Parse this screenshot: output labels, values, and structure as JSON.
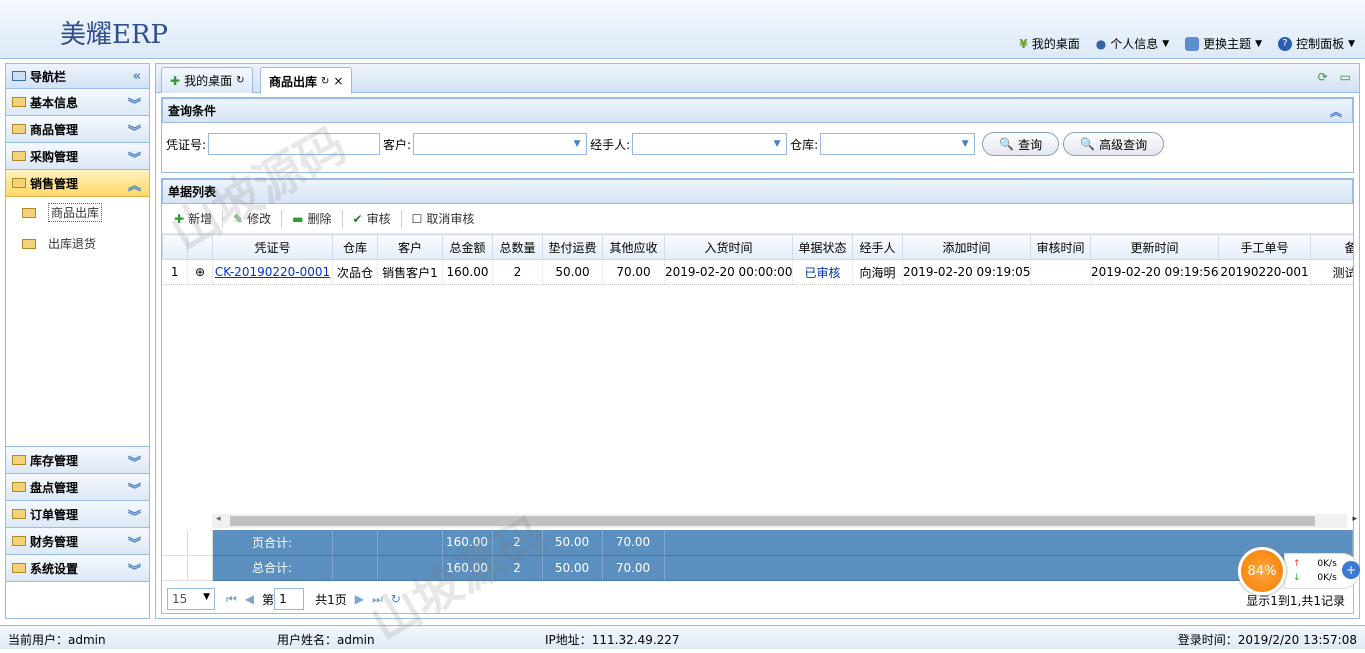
{
  "app": {
    "title": "美耀ERP"
  },
  "topmenu": [
    {
      "label": "我的桌面",
      "icon": "yen-icon",
      "caret": false
    },
    {
      "label": "个人信息",
      "icon": "user-icon",
      "caret": true
    },
    {
      "label": "更换主题",
      "icon": "theme-icon",
      "caret": true
    },
    {
      "label": "控制面板",
      "icon": "help-icon",
      "caret": true
    }
  ],
  "sidebar": {
    "title": "导航栏",
    "groups": [
      {
        "label": "基本信息"
      },
      {
        "label": "商品管理"
      },
      {
        "label": "采购管理"
      },
      {
        "label": "销售管理",
        "active": true
      }
    ],
    "subitems": [
      {
        "label": "商品出库"
      },
      {
        "label": "出库退货"
      }
    ],
    "groups_bottom": [
      {
        "label": "库存管理"
      },
      {
        "label": "盘点管理"
      },
      {
        "label": "订单管理"
      },
      {
        "label": "财务管理"
      },
      {
        "label": "系统设置"
      }
    ]
  },
  "tabs": [
    {
      "label": "我的桌面"
    },
    {
      "label": "商品出库"
    }
  ],
  "query": {
    "title": "查询条件",
    "voucher_label": "凭证号:",
    "customer_label": "客户:",
    "handler_label": "经手人:",
    "warehouse_label": "仓库:",
    "search_btn": "查询",
    "adv_search_btn": "高级查询"
  },
  "list": {
    "title": "单据列表",
    "toolbar": {
      "add": "新增",
      "edit": "修改",
      "delete": "删除",
      "approve": "审核",
      "unapprove": "取消审核"
    },
    "columns": [
      "凭证号",
      "仓库",
      "客户",
      "总金额",
      "总数量",
      "垫付运费",
      "其他应收",
      "入货时间",
      "单据状态",
      "经手人",
      "添加时间",
      "审核时间",
      "更新时间",
      "手工单号",
      "备注"
    ],
    "rows": [
      {
        "num": "1",
        "voucher": "CK-20190220-0001",
        "warehouse": "次品仓",
        "customer": "销售客户1",
        "total": "160.00",
        "qty": "2",
        "freight": "50.00",
        "other": "70.00",
        "in_time": "2019-02-20 00:00:00",
        "status": "已审核",
        "handler": "向海明",
        "add_time": "2019-02-20 09:19:05",
        "audit_time": "",
        "update_time": "2019-02-20 09:19:56",
        "manual_no": "20190220-001",
        "remark": "测试出库"
      }
    ],
    "footer": [
      {
        "label": "页合计:",
        "total": "160.00",
        "qty": "2",
        "freight": "50.00",
        "other": "70.00"
      },
      {
        "label": "总合计:",
        "total": "160.00",
        "qty": "2",
        "freight": "50.00",
        "other": "70.00"
      }
    ],
    "pager": {
      "page_size": "15",
      "page_prefix": "第",
      "page": "1",
      "page_total": "共1页",
      "info": "显示1到1,共1记录"
    }
  },
  "net_widget": {
    "percent": "84%",
    "up": "0K/s",
    "down": "0K/s"
  },
  "status": {
    "user": "当前用户：admin",
    "name": "用户姓名：admin",
    "ip": "IP地址：111.32.49.227",
    "login": "登录时间：2019/2/20 13:57:08"
  },
  "watermark": "山坡源码"
}
